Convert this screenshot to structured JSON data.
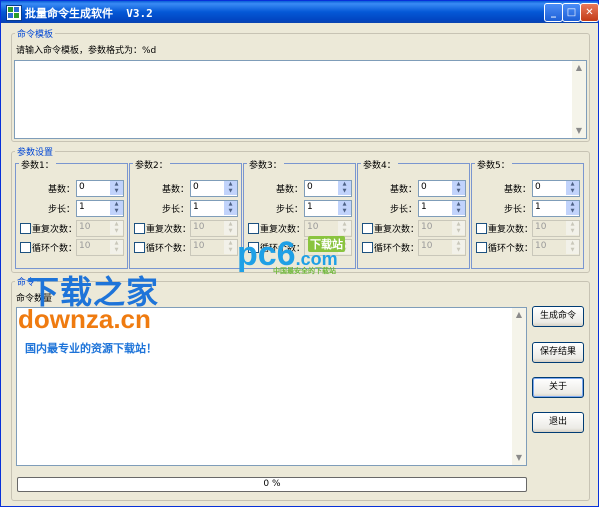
{
  "window": {
    "title": "批量命令生成软件  V3.2",
    "min_label": "_",
    "max_label": "□",
    "close_label": "✕"
  },
  "template": {
    "group_title": "命令模板",
    "hint": "请输入命令模板，参数格式为：%d",
    "value": ""
  },
  "params": {
    "group_title": "参数设置",
    "base_label": "基数：",
    "step_label": "步长：",
    "repeat_label": "重复次数：",
    "loop_label": "循环个数：",
    "items": [
      {
        "title": "参数1：",
        "base": "0",
        "step": "1",
        "repeat": "10",
        "loop": "10"
      },
      {
        "title": "参数2：",
        "base": "0",
        "step": "1",
        "repeat": "10",
        "loop": "10"
      },
      {
        "title": "参数3：",
        "base": "0",
        "step": "1",
        "repeat": "10",
        "loop": "10"
      },
      {
        "title": "参数4：",
        "base": "0",
        "step": "1",
        "repeat": "10",
        "loop": "10"
      },
      {
        "title": "参数5：",
        "base": "0",
        "step": "1",
        "repeat": "10",
        "loop": "10"
      }
    ]
  },
  "result": {
    "group_title": "命令",
    "count_label": "命令数量",
    "value": ""
  },
  "buttons": {
    "generate": "生成命令",
    "save": "保存结果",
    "about": "关于",
    "exit": "退出"
  },
  "progress": {
    "label": "0 %",
    "value": 0
  },
  "watermarks": {
    "pc6_logo": "pc6",
    "pc6_suffix": ".com",
    "pc6_tag": "下载站",
    "pc6_slogan": "中国最安全的下载站",
    "downza_cn": "下载之家",
    "downza_en": "downza.cn",
    "downza_slogan": "国内最专业的资源下载站！"
  },
  "colors": {
    "accent": "#0046d5",
    "titlebar": "#0458d6"
  }
}
